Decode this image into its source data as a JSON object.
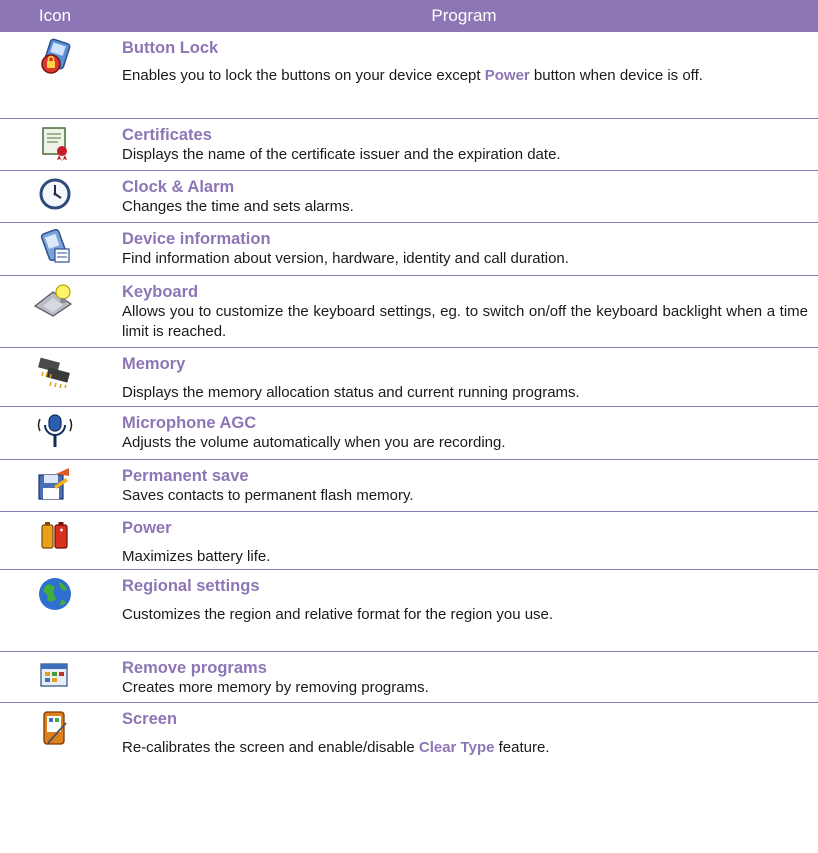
{
  "header": {
    "icon": "Icon",
    "program": "Program"
  },
  "rows": [
    {
      "icon": "button-lock-icon",
      "title": "Button Lock",
      "desc_a": "Enables you to lock the buttons on your device except ",
      "desc_em": "Power",
      "desc_b": " button when device is off."
    },
    {
      "icon": "certificates-icon",
      "title": "Certificates",
      "desc": "Displays the name of the certificate issuer and the expiration date."
    },
    {
      "icon": "clock-icon",
      "title": "Clock & Alarm",
      "desc": "Changes the time and sets alarms."
    },
    {
      "icon": "device-information-icon",
      "title": "Device information",
      "desc": "Find information about version, hardware, identity and call duration."
    },
    {
      "icon": "keyboard-icon",
      "title": "Keyboard",
      "desc": "Allows you to customize the keyboard settings, eg. to switch on/off the keyboard backlight when a time limit is reached."
    },
    {
      "icon": "memory-icon",
      "title": "Memory",
      "desc": "Displays the memory allocation status and current running programs."
    },
    {
      "icon": "microphone-icon",
      "title": "Microphone AGC",
      "desc": "Adjusts the volume automatically when you are recording."
    },
    {
      "icon": "permanent-save-icon",
      "title": "Permanent save",
      "desc": "Saves contacts to permanent flash memory."
    },
    {
      "icon": "battery-icon",
      "title": "Power",
      "desc": "Maximizes battery life."
    },
    {
      "icon": "globe-icon",
      "title": "Regional settings",
      "desc": "Customizes the region and relative format for the region you use."
    },
    {
      "icon": "remove-programs-icon",
      "title": "Remove programs",
      "desc": "Creates more memory by removing programs."
    },
    {
      "icon": "screen-icon",
      "title": "Screen",
      "desc_a": "Re-calibrates the screen and enable/disable ",
      "desc_em": "Clear Type",
      "desc_b": " feature."
    }
  ]
}
